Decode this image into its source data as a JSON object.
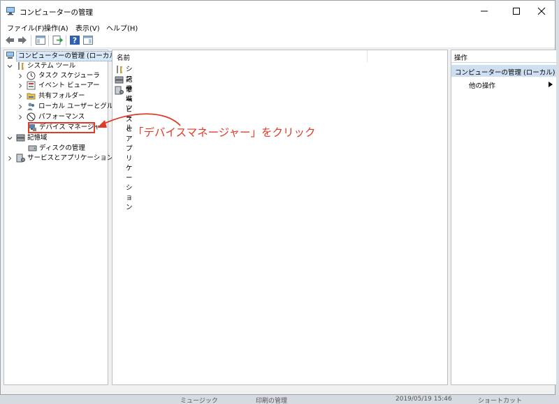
{
  "window": {
    "title": "コンピューターの管理"
  },
  "menu": [
    "ファイル(F)",
    "操作(A)",
    "表示(V)",
    "ヘルプ(H)"
  ],
  "tree": {
    "root": "コンピューターの管理 (ローカル)",
    "system_tools": "システム ツール",
    "task_scheduler": "タスク スケジューラ",
    "event_viewer": "イベント ビューアー",
    "shared_folders": "共有フォルダー",
    "local_users": "ローカル ユーザーとグループ",
    "performance": "パフォーマンス",
    "device_manager": "デバイス マネージャー",
    "storage": "記憶域",
    "disk_management": "ディスクの管理",
    "services_apps": "サービスとアプリケーション"
  },
  "list": {
    "column_name": "名前",
    "items": [
      "システム ツール",
      "記憶域",
      "サービスとアプリケーション"
    ]
  },
  "actions": {
    "header": "操作",
    "selected": "コンピューターの管理 (ローカル)",
    "other": "他の操作"
  },
  "annotation": "「デバイスマネージャー」をクリック",
  "background": {
    "item1": "ミュージック",
    "item2": "印刷の管理",
    "date": "2019/05/19 15:46",
    "type": "ショートカット"
  },
  "colors": {
    "accent_red": "#e03b26",
    "selection_blue": "#cfdff2"
  }
}
